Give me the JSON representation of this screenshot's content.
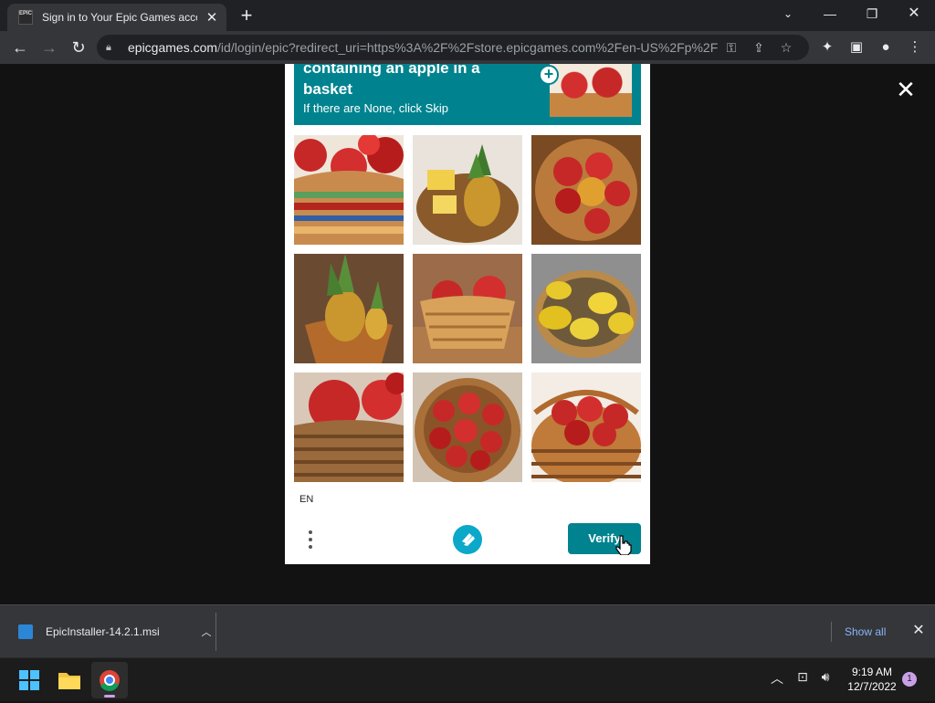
{
  "browser": {
    "tab_title": "Sign in to Your Epic Games accou",
    "tab_favicon_text": "EPIC\nGAMES",
    "url_domain": "epicgames.com",
    "url_path": "/id/login/epic?redirect_uri=https%3A%2F%2Fstore.epicgames.com%2Fen-US%2Fp%2F..."
  },
  "captcha": {
    "prompt_line1": "containing an apple in a",
    "prompt_line2": "basket",
    "prompt_hint": "If there are None, click Skip",
    "language": "EN",
    "verify_label": "Verify",
    "tiles": [
      {
        "subject": "red apples in striped woven basket"
      },
      {
        "subject": "pineapple and cheese in basket"
      },
      {
        "subject": "red apples in wicker basket"
      },
      {
        "subject": "pineapples in clay pot"
      },
      {
        "subject": "red apples in small basket on table"
      },
      {
        "subject": "lemons in wicker basket"
      },
      {
        "subject": "red apples in basket close-up"
      },
      {
        "subject": "red apples in round basket"
      },
      {
        "subject": "red apples in woven basket"
      }
    ]
  },
  "downloads": {
    "file_name": "EpicInstaller-14.2.1.msi",
    "show_all_label": "Show all"
  },
  "taskbar": {
    "time": "9:19 AM",
    "date": "12/7/2022",
    "notification_count": "1"
  },
  "colors": {
    "captcha_accent": "#00838f",
    "chrome_dark": "#202124",
    "chrome_toolbar": "#35363a"
  }
}
